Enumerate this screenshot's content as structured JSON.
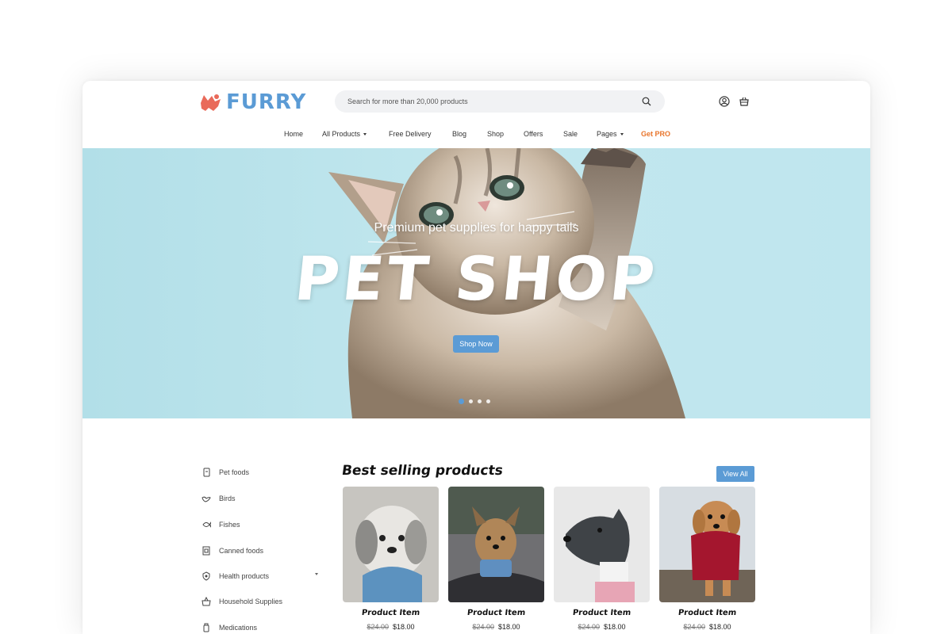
{
  "brand": {
    "name": "FURRY",
    "accent": "#5b9bd5",
    "logo_mark_color": "#e96a5a",
    "pro_color": "#e8752c"
  },
  "search": {
    "placeholder": "Search for more than 20,000 products"
  },
  "header_icons": [
    "user-icon",
    "cart-icon",
    "search-icon"
  ],
  "nav": {
    "items": [
      {
        "label": "Home"
      },
      {
        "label": "All Products"
      },
      {
        "label": "Free Delivery"
      },
      {
        "label": "Blog"
      },
      {
        "label": "Shop"
      },
      {
        "label": "Offers"
      },
      {
        "label": "Sale"
      },
      {
        "label": "Pages"
      },
      {
        "label": "Get PRO"
      }
    ]
  },
  "hero": {
    "subtitle": "Premium pet supplies for happy tails",
    "title": "PET SHOP",
    "button": "Shop Now",
    "slides": 4,
    "active_slide": 1
  },
  "categories": [
    {
      "label": "Pet foods",
      "icon": "food-bag-icon"
    },
    {
      "label": "Birds",
      "icon": "bird-icon"
    },
    {
      "label": "Fishes",
      "icon": "fish-icon"
    },
    {
      "label": "Canned foods",
      "icon": "can-icon"
    },
    {
      "label": "Health products",
      "icon": "shield-icon"
    },
    {
      "label": "Household Supplies",
      "icon": "basket-icon"
    },
    {
      "label": "Medications",
      "icon": "medicine-icon"
    }
  ],
  "products_section": {
    "title": "Best selling products",
    "view_all": "View All",
    "items": [
      {
        "name": "Product Item",
        "old_price": "$24.00",
        "price": "$18.00"
      },
      {
        "name": "Product Item",
        "old_price": "$24.00",
        "price": "$18.00"
      },
      {
        "name": "Product Item",
        "old_price": "$24.00",
        "price": "$18.00"
      },
      {
        "name": "Product Item",
        "old_price": "$24.00",
        "price": "$18.00"
      }
    ]
  }
}
